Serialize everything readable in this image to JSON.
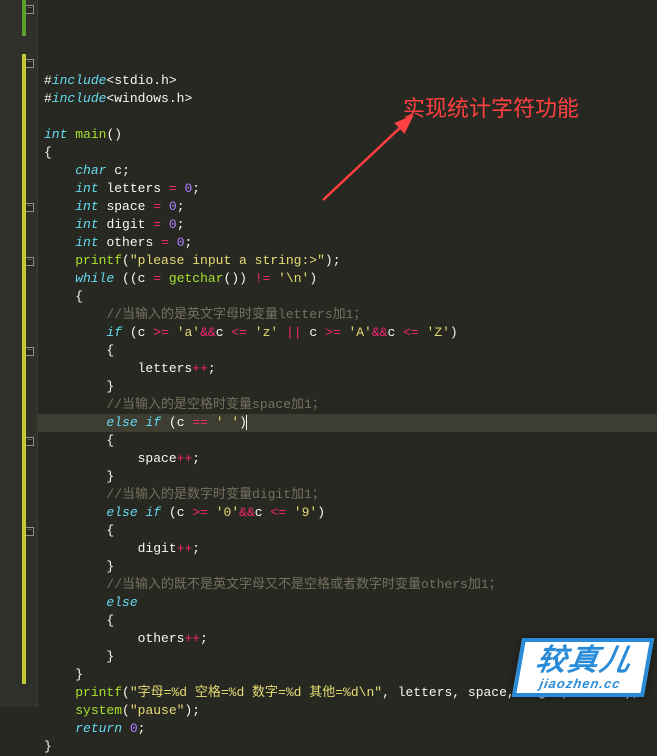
{
  "annotation": "实现统计字符功能",
  "watermark": {
    "cn": "较真儿",
    "py": "jiaozhen.cc"
  },
  "code": {
    "lines": [
      {
        "seg": [
          [
            "punct",
            "#"
          ],
          [
            "kw",
            "include"
          ],
          [
            "punct",
            "<"
          ],
          [
            "ident",
            "stdio"
          ],
          [
            "punct",
            "."
          ],
          [
            "ident",
            "h"
          ],
          [
            "punct",
            ">"
          ]
        ],
        "fold": true,
        "bar": "green",
        "noindent": true
      },
      {
        "seg": [
          [
            "punct",
            "#"
          ],
          [
            "kw",
            "include"
          ],
          [
            "punct",
            "<"
          ],
          [
            "ident",
            "windows"
          ],
          [
            "punct",
            "."
          ],
          [
            "ident",
            "h"
          ],
          [
            "punct",
            ">"
          ]
        ],
        "bar": "green",
        "noindent": true
      },
      {
        "seg": []
      },
      {
        "seg": [
          [
            "type",
            "int"
          ],
          [
            "sp",
            " "
          ],
          [
            "fn",
            "main"
          ],
          [
            "punct",
            "()"
          ]
        ],
        "fold": true,
        "bar": "yellow"
      },
      {
        "seg": [
          [
            "punct",
            "{"
          ]
        ],
        "bar": "yellow"
      },
      {
        "seg": [
          [
            "sp",
            "    "
          ],
          [
            "type",
            "char"
          ],
          [
            "sp",
            " "
          ],
          [
            "ident",
            "c"
          ],
          [
            "punct",
            ";"
          ]
        ],
        "bar": "yellow"
      },
      {
        "seg": [
          [
            "sp",
            "    "
          ],
          [
            "type",
            "int"
          ],
          [
            "sp",
            " "
          ],
          [
            "ident",
            "letters"
          ],
          [
            "sp",
            " "
          ],
          [
            "op",
            "="
          ],
          [
            "sp",
            " "
          ],
          [
            "num",
            "0"
          ],
          [
            "punct",
            ";"
          ]
        ],
        "bar": "yellow"
      },
      {
        "seg": [
          [
            "sp",
            "    "
          ],
          [
            "type",
            "int"
          ],
          [
            "sp",
            " "
          ],
          [
            "ident",
            "space"
          ],
          [
            "sp",
            " "
          ],
          [
            "op",
            "="
          ],
          [
            "sp",
            " "
          ],
          [
            "num",
            "0"
          ],
          [
            "punct",
            ";"
          ]
        ],
        "bar": "yellow"
      },
      {
        "seg": [
          [
            "sp",
            "    "
          ],
          [
            "type",
            "int"
          ],
          [
            "sp",
            " "
          ],
          [
            "ident",
            "digit"
          ],
          [
            "sp",
            " "
          ],
          [
            "op",
            "="
          ],
          [
            "sp",
            " "
          ],
          [
            "num",
            "0"
          ],
          [
            "punct",
            ";"
          ]
        ],
        "bar": "yellow"
      },
      {
        "seg": [
          [
            "sp",
            "    "
          ],
          [
            "type",
            "int"
          ],
          [
            "sp",
            " "
          ],
          [
            "ident",
            "others"
          ],
          [
            "sp",
            " "
          ],
          [
            "op",
            "="
          ],
          [
            "sp",
            " "
          ],
          [
            "num",
            "0"
          ],
          [
            "punct",
            ";"
          ]
        ],
        "bar": "yellow"
      },
      {
        "seg": [
          [
            "sp",
            "    "
          ],
          [
            "fn",
            "printf"
          ],
          [
            "punct",
            "("
          ],
          [
            "str",
            "\"please input a string:>\""
          ],
          [
            "punct",
            ")"
          ],
          [
            "punct",
            ";"
          ]
        ],
        "bar": "yellow"
      },
      {
        "seg": [
          [
            "sp",
            "    "
          ],
          [
            "kw",
            "while"
          ],
          [
            "sp",
            " "
          ],
          [
            "punct",
            "(("
          ],
          [
            "ident",
            "c"
          ],
          [
            "sp",
            " "
          ],
          [
            "op",
            "="
          ],
          [
            "sp",
            " "
          ],
          [
            "fn",
            "getchar"
          ],
          [
            "punct",
            "()) "
          ],
          [
            "op",
            "!="
          ],
          [
            "sp",
            " "
          ],
          [
            "chr",
            "'\\n'"
          ],
          [
            "punct",
            ")"
          ]
        ],
        "fold": true,
        "bar": "yellow"
      },
      {
        "seg": [
          [
            "sp",
            "    "
          ],
          [
            "punct",
            "{"
          ]
        ],
        "bar": "yellow"
      },
      {
        "seg": [
          [
            "sp",
            "        "
          ],
          [
            "cmt",
            "//当输入的是英文字母时变量letters加1；"
          ]
        ],
        "bar": "yellow"
      },
      {
        "seg": [
          [
            "sp",
            "        "
          ],
          [
            "kw",
            "if"
          ],
          [
            "sp",
            " "
          ],
          [
            "punct",
            "("
          ],
          [
            "ident",
            "c"
          ],
          [
            "sp",
            " "
          ],
          [
            "op",
            ">="
          ],
          [
            "sp",
            " "
          ],
          [
            "chr",
            "'a'"
          ],
          [
            "op",
            "&&"
          ],
          [
            "ident",
            "c"
          ],
          [
            "sp",
            " "
          ],
          [
            "op",
            "<="
          ],
          [
            "sp",
            " "
          ],
          [
            "chr",
            "'z'"
          ],
          [
            "sp",
            " "
          ],
          [
            "op",
            "||"
          ],
          [
            "sp",
            " "
          ],
          [
            "ident",
            "c"
          ],
          [
            "sp",
            " "
          ],
          [
            "op",
            ">="
          ],
          [
            "sp",
            " "
          ],
          [
            "chr",
            "'A'"
          ],
          [
            "op",
            "&&"
          ],
          [
            "ident",
            "c"
          ],
          [
            "sp",
            " "
          ],
          [
            "op",
            "<="
          ],
          [
            "sp",
            " "
          ],
          [
            "chr",
            "'Z'"
          ],
          [
            "punct",
            ")"
          ]
        ],
        "fold": true,
        "bar": "yellow"
      },
      {
        "seg": [
          [
            "sp",
            "        "
          ],
          [
            "punct",
            "{"
          ]
        ],
        "bar": "yellow"
      },
      {
        "seg": [
          [
            "sp",
            "            "
          ],
          [
            "ident",
            "letters"
          ],
          [
            "op",
            "++"
          ],
          [
            "punct",
            ";"
          ]
        ],
        "bar": "yellow"
      },
      {
        "seg": [
          [
            "sp",
            "        "
          ],
          [
            "punct",
            "}"
          ]
        ],
        "bar": "yellow"
      },
      {
        "seg": [
          [
            "sp",
            "        "
          ],
          [
            "cmt",
            "//当输入的是空格时变量space加1；"
          ]
        ],
        "bar": "yellow"
      },
      {
        "seg": [
          [
            "sp",
            "        "
          ],
          [
            "kw",
            "else"
          ],
          [
            "sp",
            " "
          ],
          [
            "kw",
            "if"
          ],
          [
            "sp",
            " "
          ],
          [
            "punct",
            "("
          ],
          [
            "ident",
            "c"
          ],
          [
            "sp",
            " "
          ],
          [
            "op",
            "=="
          ],
          [
            "sp",
            " "
          ],
          [
            "chr",
            "' '"
          ],
          [
            "punct",
            ")"
          ]
        ],
        "fold": true,
        "bar": "yellow",
        "cursor": true
      },
      {
        "seg": [
          [
            "sp",
            "        "
          ],
          [
            "punct",
            "{"
          ]
        ],
        "bar": "yellow"
      },
      {
        "seg": [
          [
            "sp",
            "            "
          ],
          [
            "ident",
            "space"
          ],
          [
            "op",
            "++"
          ],
          [
            "punct",
            ";"
          ]
        ],
        "bar": "yellow"
      },
      {
        "seg": [
          [
            "sp",
            "        "
          ],
          [
            "punct",
            "}"
          ]
        ],
        "bar": "yellow"
      },
      {
        "seg": [
          [
            "sp",
            "        "
          ],
          [
            "cmt",
            "//当输入的是数字时变量digit加1；"
          ]
        ],
        "bar": "yellow"
      },
      {
        "seg": [
          [
            "sp",
            "        "
          ],
          [
            "kw",
            "else"
          ],
          [
            "sp",
            " "
          ],
          [
            "kw",
            "if"
          ],
          [
            "sp",
            " "
          ],
          [
            "punct",
            "("
          ],
          [
            "ident",
            "c"
          ],
          [
            "sp",
            " "
          ],
          [
            "op",
            ">="
          ],
          [
            "sp",
            " "
          ],
          [
            "chr",
            "'0'"
          ],
          [
            "op",
            "&&"
          ],
          [
            "ident",
            "c"
          ],
          [
            "sp",
            " "
          ],
          [
            "op",
            "<="
          ],
          [
            "sp",
            " "
          ],
          [
            "chr",
            "'9'"
          ],
          [
            "punct",
            ")"
          ]
        ],
        "fold": true,
        "bar": "yellow"
      },
      {
        "seg": [
          [
            "sp",
            "        "
          ],
          [
            "punct",
            "{"
          ]
        ],
        "bar": "yellow"
      },
      {
        "seg": [
          [
            "sp",
            "            "
          ],
          [
            "ident",
            "digit"
          ],
          [
            "op",
            "++"
          ],
          [
            "punct",
            ";"
          ]
        ],
        "bar": "yellow"
      },
      {
        "seg": [
          [
            "sp",
            "        "
          ],
          [
            "punct",
            "}"
          ]
        ],
        "bar": "yellow"
      },
      {
        "seg": [
          [
            "sp",
            "        "
          ],
          [
            "cmt",
            "//当输入的既不是英文字母又不是空格或者数字时变量others加1；"
          ]
        ],
        "bar": "yellow"
      },
      {
        "seg": [
          [
            "sp",
            "        "
          ],
          [
            "kw",
            "else"
          ]
        ],
        "fold": true,
        "bar": "yellow"
      },
      {
        "seg": [
          [
            "sp",
            "        "
          ],
          [
            "punct",
            "{"
          ]
        ],
        "bar": "yellow"
      },
      {
        "seg": [
          [
            "sp",
            "            "
          ],
          [
            "ident",
            "others"
          ],
          [
            "op",
            "++"
          ],
          [
            "punct",
            ";"
          ]
        ],
        "bar": "yellow"
      },
      {
        "seg": [
          [
            "sp",
            "        "
          ],
          [
            "punct",
            "}"
          ]
        ],
        "bar": "yellow"
      },
      {
        "seg": [
          [
            "sp",
            "    "
          ],
          [
            "punct",
            "}"
          ]
        ],
        "bar": "yellow"
      },
      {
        "seg": [
          [
            "sp",
            "    "
          ],
          [
            "fn",
            "printf"
          ],
          [
            "punct",
            "("
          ],
          [
            "str",
            "\"字母=%d 空格=%d 数字=%d 其他=%d\\n\""
          ],
          [
            "punct",
            ", "
          ],
          [
            "ident",
            "letters"
          ],
          [
            "punct",
            ", "
          ],
          [
            "ident",
            "space"
          ],
          [
            "punct",
            ", "
          ],
          [
            "ident",
            "digit"
          ],
          [
            "punct",
            ", "
          ],
          [
            "ident",
            "others"
          ],
          [
            "punct",
            ")"
          ],
          [
            "punct",
            ";"
          ]
        ],
        "bar": "yellow"
      },
      {
        "seg": [
          [
            "sp",
            "    "
          ],
          [
            "fn",
            "system"
          ],
          [
            "punct",
            "("
          ],
          [
            "str",
            "\"pause\""
          ],
          [
            "punct",
            ")"
          ],
          [
            "punct",
            ";"
          ]
        ],
        "bar": "yellow"
      },
      {
        "seg": [
          [
            "sp",
            "    "
          ],
          [
            "kw",
            "return"
          ],
          [
            "sp",
            " "
          ],
          [
            "num",
            "0"
          ],
          [
            "punct",
            ";"
          ]
        ],
        "bar": "yellow"
      },
      {
        "seg": [
          [
            "punct",
            "}"
          ]
        ],
        "bar": "yellow"
      }
    ]
  }
}
